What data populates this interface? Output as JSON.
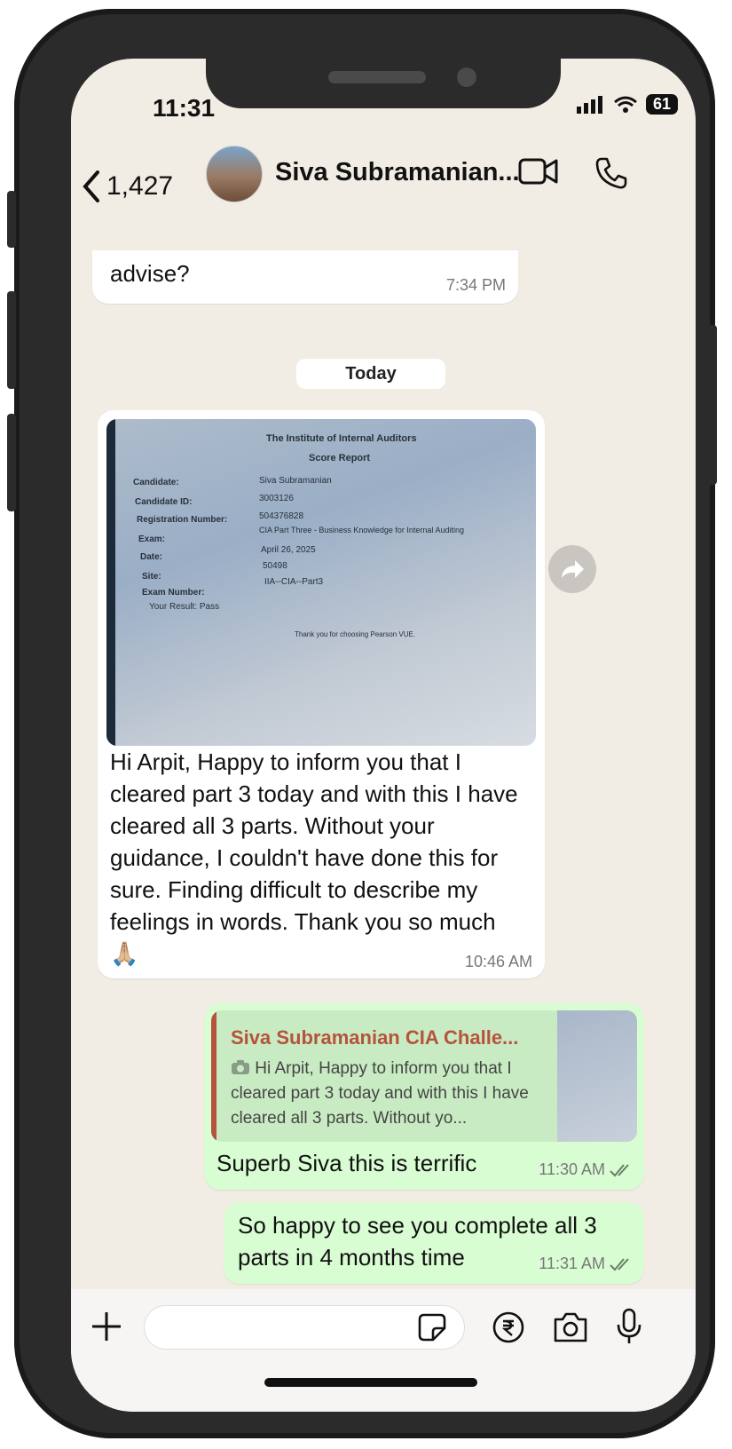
{
  "status": {
    "time": "11:31",
    "battery": "61"
  },
  "header": {
    "back_count": "1,427",
    "contact_name": "Siva Subramanian..."
  },
  "chat": {
    "prev_message": {
      "text": "advise?",
      "time": "7:34 PM"
    },
    "date_chip": "Today",
    "incoming": {
      "photo_lines": {
        "title": "The Institute of Internal Auditors",
        "subtitle": "Score Report",
        "candidate_label": "Candidate:",
        "candidate_value": "Siva Subramanian",
        "id_label": "Candidate ID:",
        "id_value": "3003126",
        "reg_label": "Registration Number:",
        "reg_value": "504376828",
        "exam_label": "Exam:",
        "exam_value": "CIA Part Three - Business Knowledge for Internal Auditing",
        "date_label": "Date:",
        "date_value": "April 26, 2025",
        "site_label": "Site:",
        "site_value": "50498",
        "examno_label": "Exam Number:",
        "examno_value": "IIA--CIA--Part3",
        "result": "Your Result: Pass",
        "thanks": "Thank you for choosing Pearson VUE."
      },
      "text": "Hi Arpit, Happy to inform you that I cleared part 3 today and with this I have cleared all 3 parts. Without your guidance, I couldn't have done this for sure. Finding difficult to describe my feelings in words. Thank you so much 🙏🏼",
      "time": "10:46 AM"
    },
    "reply": {
      "quoted_name": "Siva Subramanian CIA Challe...",
      "quoted_text": "Hi Arpit, Happy to inform you that I cleared part 3 today and with this I have cleared all 3 parts. Without yo...",
      "text": "Superb Siva this is terrific",
      "time": "11:30 AM"
    },
    "outgoing2": {
      "text": "So happy to see you complete all 3 parts in 4 months time",
      "time": "11:31 AM"
    }
  },
  "icons": [
    "chevron-left-icon",
    "video-call-icon",
    "phone-icon",
    "forward-icon",
    "plus-icon",
    "sticker-icon",
    "rupee-icon",
    "camera-icon",
    "mic-icon",
    "double-check-icon"
  ]
}
